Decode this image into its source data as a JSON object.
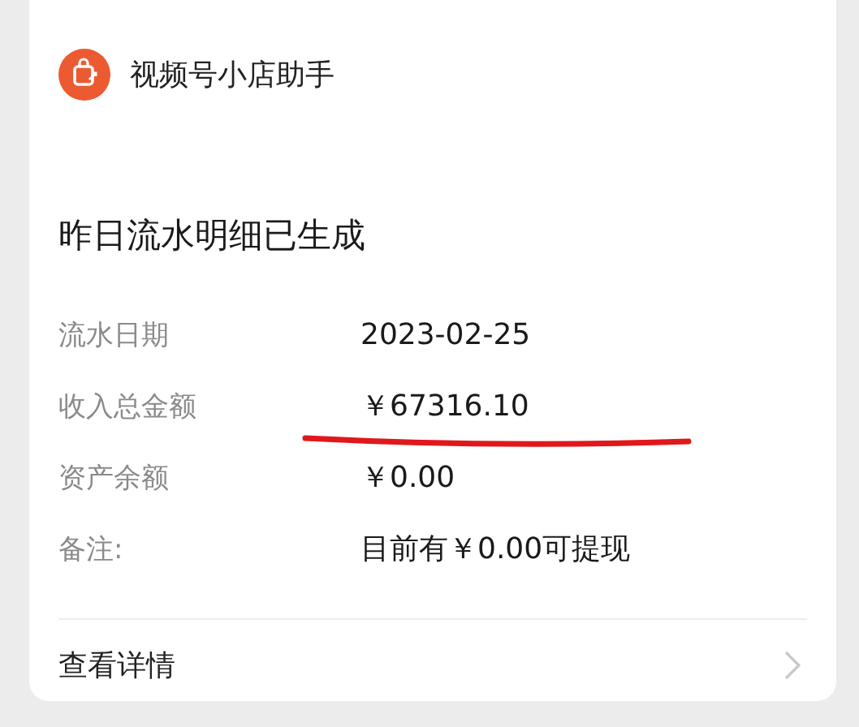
{
  "app": {
    "name": "视频号小店助手"
  },
  "message": {
    "title": "昨日流水明细已生成",
    "fields": [
      {
        "label": "流水日期",
        "value": "2023-02-25",
        "underlined": false
      },
      {
        "label": "收入总金额",
        "value": "￥67316.10",
        "underlined": true
      },
      {
        "label": "资产余额",
        "value": "￥0.00",
        "underlined": false
      },
      {
        "label": "备注:",
        "value": "目前有￥0.00可提现",
        "underlined": false
      }
    ]
  },
  "footer": {
    "link": "查看详情"
  }
}
